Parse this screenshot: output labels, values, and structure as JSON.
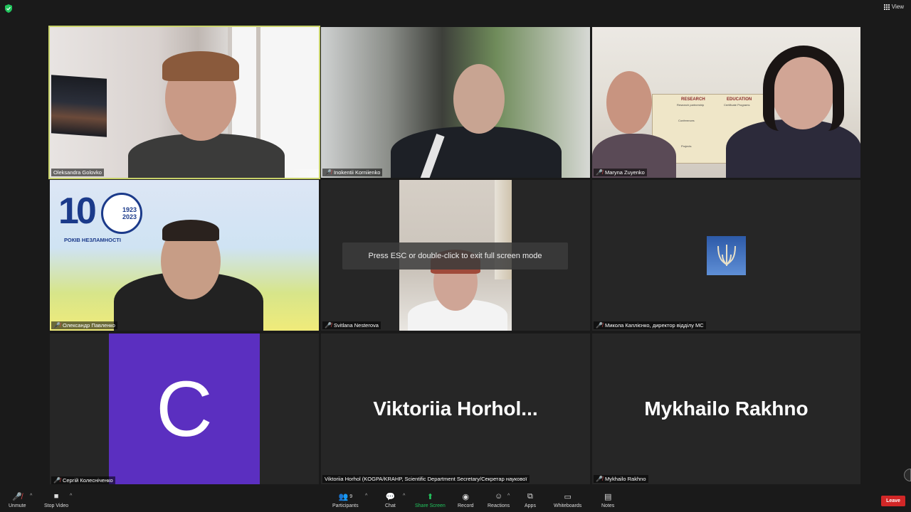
{
  "topbar": {
    "view_label": "View"
  },
  "participants": [
    {
      "name": "Oleksandra Golovko",
      "muted": false
    },
    {
      "name": "Inokentii Korniienko",
      "muted": true
    },
    {
      "name": "Maryna Zuyenko",
      "muted": true
    },
    {
      "name": "Олександр Павленко",
      "muted": true
    },
    {
      "name": "Svitlana Nesterova",
      "muted": true
    },
    {
      "name": "Микола Каплієнко, директор відділу МС",
      "muted": true
    },
    {
      "name": "Сергій Колесніченко",
      "muted": true,
      "avatar_letter": "C"
    },
    {
      "name": "Viktoriia Horhol (KOGPA/KRAHP, Scientific Department Secretary/Секретар наукової",
      "display": "Viktoriia  Horhol...",
      "muted": false
    },
    {
      "name": "Mykhailo Rakhno",
      "display": "Mykhailo Rakhno",
      "muted": true
    }
  ],
  "logo": {
    "line1": "1923",
    "line2": "2023",
    "caption": "РОКІВ НЕЗЛАМНОСТІ",
    "big": "10"
  },
  "poster": {
    "research": "RESEARCH",
    "research_sub": "Research partnership",
    "conferences": "Conferences",
    "projects": "Projects",
    "education": "EDUCATION",
    "education_sub": "Certificate Programs"
  },
  "fullscreen_message": "Press ESC or double-click to exit full screen mode",
  "toolbar": {
    "unmute": "Unmute",
    "stop_video": "Stop Video",
    "participants": "Participants",
    "participants_count": "9",
    "chat": "Chat",
    "share_screen": "Share Screen",
    "record": "Record",
    "reactions": "Reactions",
    "apps": "Apps",
    "whiteboards": "Whiteboards",
    "notes": "Notes",
    "leave": "Leave"
  },
  "colors": {
    "active_border": "#c9d36b",
    "share_green": "#22c55e",
    "leave_red": "#d22727",
    "avatar_purple": "#5b2fc0"
  }
}
